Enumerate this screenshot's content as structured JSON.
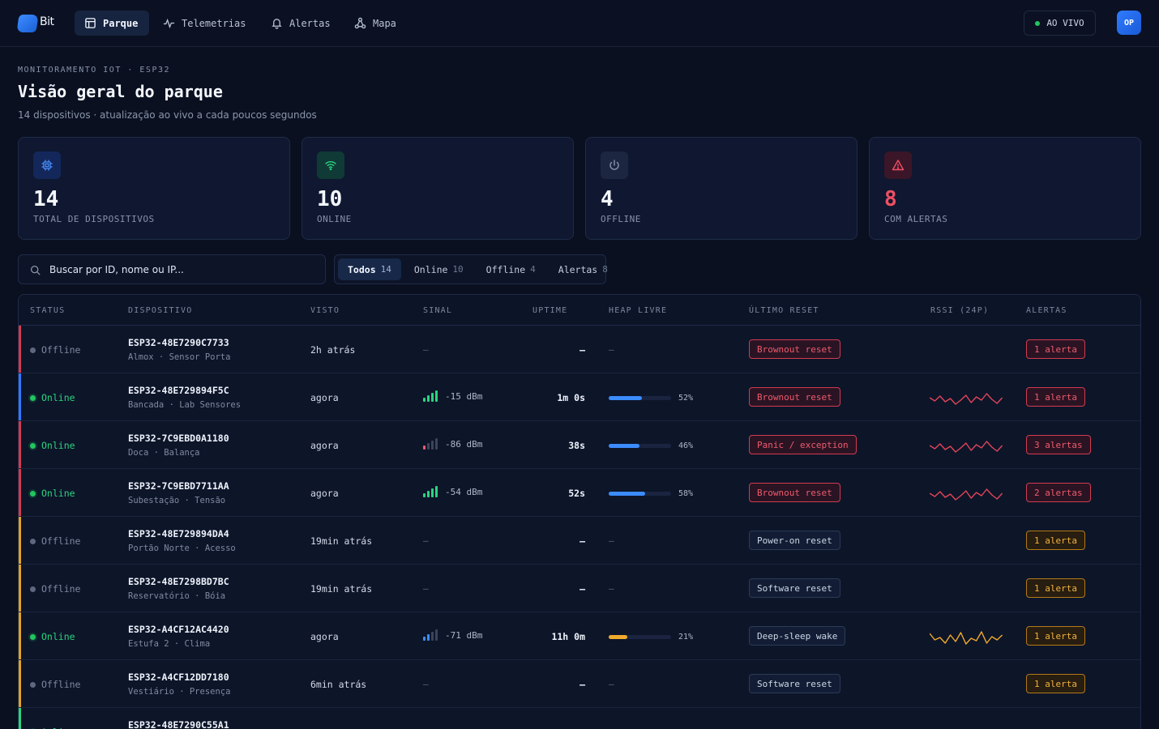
{
  "app": {
    "logo_text": "Bit"
  },
  "nav": {
    "tabs": [
      {
        "label": "Parque",
        "icon": "layout-icon",
        "active": true
      },
      {
        "label": "Telemetrias",
        "icon": "pulse-icon",
        "active": false
      },
      {
        "label": "Alertas",
        "icon": "bell-icon",
        "active": false
      },
      {
        "label": "Mapa",
        "icon": "network-icon",
        "active": false
      }
    ],
    "live_label": "AO VIVO",
    "avatar_initials": "OP"
  },
  "header": {
    "breadcrumb": "MONITORAMENTO IOT · ESP32",
    "title": "Visão geral do parque",
    "subtitle": "14 dispositivos · atualização ao vivo a cada poucos segundos"
  },
  "stats": [
    {
      "value": "14",
      "label": "TOTAL DE DISPOSITIVOS",
      "icon": "chip-icon",
      "color": "#4a90ff"
    },
    {
      "value": "10",
      "label": "ONLINE",
      "icon": "wifi-icon",
      "color": "#2bd47f"
    },
    {
      "value": "4",
      "label": "OFFLINE",
      "icon": "power-icon",
      "color": "#8793a8"
    },
    {
      "value": "8",
      "label": "COM ALERTAS",
      "icon": "warning-icon",
      "color": "#ef4f63"
    }
  ],
  "search": {
    "placeholder": "Buscar por ID, nome ou IP..."
  },
  "filters": [
    {
      "label": "Todos",
      "count": "14",
      "active": true
    },
    {
      "label": "Online",
      "count": "10",
      "active": false
    },
    {
      "label": "Offline",
      "count": "4",
      "active": false
    },
    {
      "label": "Alertas",
      "count": "8",
      "active": false
    }
  ],
  "table": {
    "columns": [
      "STATUS",
      "DISPOSITIVO",
      "VISTO",
      "SINAL",
      "UPTIME",
      "HEAP LIVRE",
      "ÚLTIMO RESET",
      "RSSI (24P)",
      "ALERTAS"
    ],
    "rows": [
      {
        "status": "Offline",
        "online": false,
        "accent": "#d23b4f",
        "id": "ESP32-48E7290C7733",
        "location": "Almox · Sensor Porta",
        "seen": "2h atrás",
        "signal": "–",
        "bars": 0,
        "uptime": "—",
        "heap": "–",
        "heap_pct": 0,
        "reset": "Brownout reset",
        "reset_bad": true,
        "spark": null,
        "alerts": "1 alerta",
        "alert_level": "red"
      },
      {
        "status": "Online",
        "online": true,
        "accent": "#2f7bff",
        "id": "ESP32-48E729894F5C",
        "location": "Bancada · Lab Sensores",
        "seen": "agora",
        "signal": "-15 dBm",
        "bars": 4,
        "bar_color": "#2bd47f",
        "uptime": "1m 0s",
        "heap": "52%",
        "heap_pct": 52,
        "heap_color": "#3b8cff",
        "reset": "Brownout reset",
        "reset_bad": true,
        "spark": "red",
        "alerts": "1 alerta",
        "alert_level": "red"
      },
      {
        "status": "Online",
        "online": true,
        "accent": "#d23b4f",
        "id": "ESP32-7C9EBD0A1180",
        "location": "Doca · Balança",
        "seen": "agora",
        "signal": "-86 dBm",
        "bars": 1,
        "bar_color": "#ef5a6c",
        "uptime": "38s",
        "heap": "46%",
        "heap_pct": 46,
        "heap_color": "#3b8cff",
        "reset": "Panic / exception",
        "reset_bad": true,
        "spark": "red",
        "alerts": "3 alertas",
        "alert_level": "red"
      },
      {
        "status": "Online",
        "online": true,
        "accent": "#d23b4f",
        "id": "ESP32-7C9EBD7711AA",
        "location": "Subestação · Tensão",
        "seen": "agora",
        "signal": "-54 dBm",
        "bars": 4,
        "bar_color": "#2bd47f",
        "uptime": "52s",
        "heap": "58%",
        "heap_pct": 58,
        "heap_color": "#3b8cff",
        "reset": "Brownout reset",
        "reset_bad": true,
        "spark": "red",
        "alerts": "2 alertas",
        "alert_level": "red"
      },
      {
        "status": "Offline",
        "online": false,
        "accent": "#e0a326",
        "id": "ESP32-48E729894DA4",
        "location": "Portão Norte · Acesso",
        "seen": "19min atrás",
        "signal": "–",
        "bars": 0,
        "uptime": "—",
        "heap": "–",
        "heap_pct": 0,
        "reset": "Power-on reset",
        "reset_bad": false,
        "spark": null,
        "alerts": "1 alerta",
        "alert_level": "amber"
      },
      {
        "status": "Offline",
        "online": false,
        "accent": "#e0a326",
        "id": "ESP32-48E7298BD7BC",
        "location": "Reservatório · Bóia",
        "seen": "19min atrás",
        "signal": "–",
        "bars": 0,
        "uptime": "—",
        "heap": "–",
        "heap_pct": 0,
        "reset": "Software reset",
        "reset_bad": false,
        "spark": null,
        "alerts": "1 alerta",
        "alert_level": "amber"
      },
      {
        "status": "Online",
        "online": true,
        "accent": "#e0a326",
        "id": "ESP32-A4CF12AC4420",
        "location": "Estufa 2 · Clima",
        "seen": "agora",
        "signal": "-71 dBm",
        "bars": 2,
        "bar_color": "#3b8cff",
        "uptime": "11h 0m",
        "heap": "21%",
        "heap_pct": 21,
        "heap_color": "#f0a92c",
        "reset": "Deep-sleep wake",
        "reset_bad": false,
        "spark": "amber",
        "alerts": "1 alerta",
        "alert_level": "amber"
      },
      {
        "status": "Offline",
        "online": false,
        "accent": "#e0a326",
        "id": "ESP32-A4CF12DD7180",
        "location": "Vestiário · Presença",
        "seen": "6min atrás",
        "signal": "–",
        "bars": 0,
        "uptime": "—",
        "heap": "–",
        "heap_pct": 0,
        "reset": "Software reset",
        "reset_bad": false,
        "spark": null,
        "alerts": "1 alerta",
        "alert_level": "amber"
      },
      {
        "status": "Online",
        "online": true,
        "accent": "#2bd47f",
        "id": "ESP32-48E7290C55A1",
        "location": "",
        "seen": "",
        "signal": "",
        "bars": 0,
        "uptime": "",
        "heap": "",
        "heap_pct": 0,
        "reset": "",
        "reset_bad": false,
        "spark": "blue",
        "alerts": "",
        "alert_level": "green"
      }
    ]
  },
  "colors": {
    "bg": "#0a1020",
    "accent_blue": "#2f7bff",
    "online": "#2bd47f",
    "danger": "#ef4f63",
    "warning": "#f0a92c"
  }
}
